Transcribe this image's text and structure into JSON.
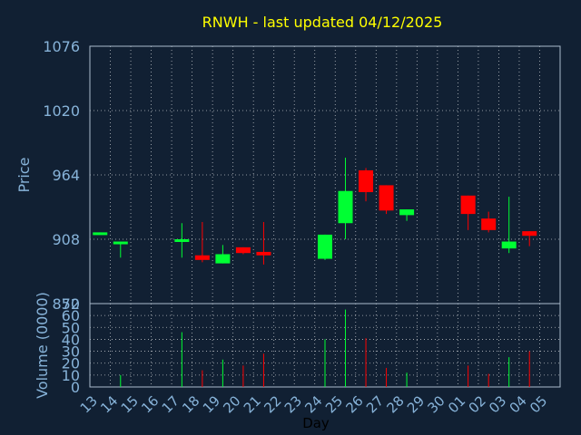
{
  "colors": {
    "background": "#112033",
    "title": "#ffff00",
    "axis_text": "#87b3d9",
    "axis_line": "#aabbcc",
    "grid": "#ffffff",
    "up": "#00ff33",
    "down": "#ff0000",
    "xlabel": "#000000"
  },
  "chart_data": [
    {
      "type": "candlestick",
      "title": "RNWH - last updated 04/12/2025",
      "ylabel": "Price",
      "ylim": [
        852,
        1076
      ],
      "yticks": [
        852,
        908,
        964,
        1020,
        1076
      ],
      "grid": true,
      "x_tick_labels": [
        "13",
        "14",
        "15",
        "16",
        "17",
        "18",
        "19",
        "20",
        "21",
        "22",
        "23",
        "24",
        "25",
        "26",
        "27",
        "28",
        "29",
        "30",
        "01",
        "02",
        "03",
        "04",
        "05"
      ],
      "candles": [
        {
          "day": "13",
          "open": 912,
          "close": 914,
          "high": 914,
          "low": 912,
          "direction": "up"
        },
        {
          "day": "14",
          "open": 904,
          "close": 906,
          "high": 906,
          "low": 892,
          "direction": "up"
        },
        {
          "day": "17",
          "open": 906,
          "close": 908,
          "high": 922,
          "low": 892,
          "direction": "up"
        },
        {
          "day": "18",
          "open": 894,
          "close": 890,
          "high": 923,
          "low": 888,
          "direction": "down"
        },
        {
          "day": "19",
          "open": 887,
          "close": 895,
          "high": 903,
          "low": 887,
          "direction": "up"
        },
        {
          "day": "20",
          "open": 901,
          "close": 896,
          "high": 901,
          "low": 895,
          "direction": "down"
        },
        {
          "day": "21",
          "open": 897,
          "close": 894,
          "high": 923,
          "low": 886,
          "direction": "down"
        },
        {
          "day": "24",
          "open": 891,
          "close": 912,
          "high": 912,
          "low": 890,
          "direction": "up"
        },
        {
          "day": "25",
          "open": 922,
          "close": 950,
          "high": 979,
          "low": 908,
          "direction": "up"
        },
        {
          "day": "26",
          "open": 968,
          "close": 949,
          "high": 970,
          "low": 941,
          "direction": "down"
        },
        {
          "day": "27",
          "open": 955,
          "close": 933,
          "high": 955,
          "low": 930,
          "direction": "down"
        },
        {
          "day": "28",
          "open": 929,
          "close": 934,
          "high": 934,
          "low": 924,
          "direction": "up"
        },
        {
          "day": "01",
          "open": 946,
          "close": 930,
          "high": 946,
          "low": 916,
          "direction": "down"
        },
        {
          "day": "02",
          "open": 926,
          "close": 916,
          "high": 932,
          "low": 914,
          "direction": "down"
        },
        {
          "day": "03",
          "open": 900,
          "close": 906,
          "high": 945,
          "low": 896,
          "direction": "up"
        },
        {
          "day": "04",
          "open": 915,
          "close": 911,
          "high": 915,
          "low": 902,
          "direction": "down"
        }
      ]
    },
    {
      "type": "bar",
      "ylabel": "Volume (0000)",
      "xlabel": "Day",
      "ylim": [
        0,
        70
      ],
      "yticks": [
        0,
        10,
        20,
        30,
        40,
        50,
        60,
        70
      ],
      "grid": true,
      "x_tick_labels": [
        "13",
        "14",
        "15",
        "16",
        "17",
        "18",
        "19",
        "20",
        "21",
        "22",
        "23",
        "24",
        "25",
        "26",
        "27",
        "28",
        "29",
        "30",
        "01",
        "02",
        "03",
        "04",
        "05"
      ],
      "bars": [
        {
          "day": "14",
          "value": 10,
          "direction": "up"
        },
        {
          "day": "17",
          "value": 46,
          "direction": "up"
        },
        {
          "day": "18",
          "value": 14,
          "direction": "down"
        },
        {
          "day": "19",
          "value": 23,
          "direction": "up"
        },
        {
          "day": "20",
          "value": 18,
          "direction": "down"
        },
        {
          "day": "21",
          "value": 28,
          "direction": "down"
        },
        {
          "day": "24",
          "value": 40,
          "direction": "up"
        },
        {
          "day": "25",
          "value": 65,
          "direction": "up"
        },
        {
          "day": "26",
          "value": 41,
          "direction": "down"
        },
        {
          "day": "27",
          "value": 16,
          "direction": "down"
        },
        {
          "day": "28",
          "value": 12,
          "direction": "up"
        },
        {
          "day": "01",
          "value": 18,
          "direction": "down"
        },
        {
          "day": "02",
          "value": 11,
          "direction": "down"
        },
        {
          "day": "03",
          "value": 25,
          "direction": "up"
        },
        {
          "day": "04",
          "value": 30,
          "direction": "down"
        }
      ]
    }
  ]
}
